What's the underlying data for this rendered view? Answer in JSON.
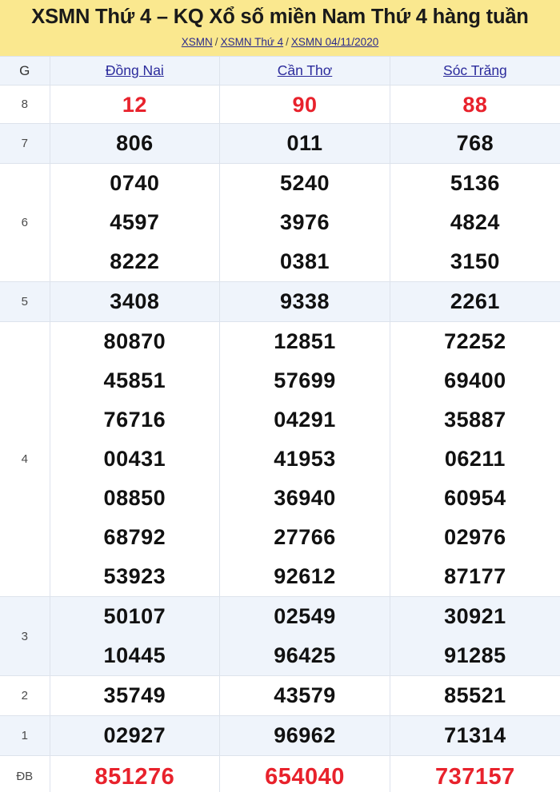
{
  "header": {
    "title": "XSMN Thứ 4 – KQ Xổ số miền Nam Thứ 4 hàng tuần",
    "background_color": "#fae88f",
    "breadcrumb": [
      {
        "label": "XSMN"
      },
      {
        "label": "XSMN Thứ 4"
      },
      {
        "label": "XSMN 04/11/2020"
      }
    ],
    "breadcrumb_separator": "/"
  },
  "table": {
    "prize_column_header": "G",
    "provinces": [
      "Đồng Nai",
      "Cần Thơ",
      "Sóc Trăng"
    ],
    "colors": {
      "alt_row": "#eff4fb",
      "plain_row": "#ffffff",
      "border": "#dde3ec",
      "highlight_number": "#e8222c",
      "link": "#2b2b9c"
    },
    "rows": [
      {
        "prize": "8",
        "highlight": true,
        "columns": [
          [
            "12"
          ],
          [
            "90"
          ],
          [
            "88"
          ]
        ]
      },
      {
        "prize": "7",
        "highlight": false,
        "columns": [
          [
            "806"
          ],
          [
            "011"
          ],
          [
            "768"
          ]
        ]
      },
      {
        "prize": "6",
        "highlight": false,
        "columns": [
          [
            "0740",
            "4597",
            "8222"
          ],
          [
            "5240",
            "3976",
            "0381"
          ],
          [
            "5136",
            "4824",
            "3150"
          ]
        ]
      },
      {
        "prize": "5",
        "highlight": false,
        "columns": [
          [
            "3408"
          ],
          [
            "9338"
          ],
          [
            "2261"
          ]
        ]
      },
      {
        "prize": "4",
        "highlight": false,
        "columns": [
          [
            "80870",
            "45851",
            "76716",
            "00431",
            "08850",
            "68792",
            "53923"
          ],
          [
            "12851",
            "57699",
            "04291",
            "41953",
            "36940",
            "27766",
            "92612"
          ],
          [
            "72252",
            "69400",
            "35887",
            "06211",
            "60954",
            "02976",
            "87177"
          ]
        ]
      },
      {
        "prize": "3",
        "highlight": false,
        "columns": [
          [
            "50107",
            "10445"
          ],
          [
            "02549",
            "96425"
          ],
          [
            "30921",
            "91285"
          ]
        ]
      },
      {
        "prize": "2",
        "highlight": false,
        "columns": [
          [
            "35749"
          ],
          [
            "43579"
          ],
          [
            "85521"
          ]
        ]
      },
      {
        "prize": "1",
        "highlight": false,
        "columns": [
          [
            "02927"
          ],
          [
            "96962"
          ],
          [
            "71314"
          ]
        ]
      },
      {
        "prize": "ĐB",
        "highlight": true,
        "columns": [
          [
            "851276"
          ],
          [
            "654040"
          ],
          [
            "737157"
          ]
        ]
      }
    ]
  }
}
